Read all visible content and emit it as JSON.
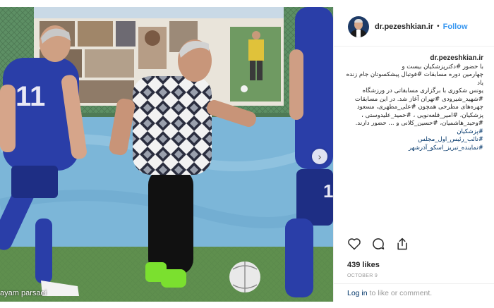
{
  "photo": {
    "credit": "ayam parsaei",
    "jersey_number_left": "11",
    "jersey_number_right": "1",
    "next_arrow": "chevron-right-icon"
  },
  "post": {
    "username": "dr.pezeshkian.ir",
    "separator": "•",
    "follow_label": "Follow",
    "caption": {
      "user": "dr.pezeshkian.ir",
      "lines": [
        "با حضور #دکترپزشکیان بیست و",
        "چهارمین دوره مسابقات #فوتبال پیشکسوتان جام زنده یاد",
        "یونس شکوری با برگزاری مسابقاتی در ورزشگاه",
        "#شهید_شیرودی #تهران آغاز شد. در این مسابقات",
        "چهره‌های مطرحی همچون #علی_مطهری، مسعود",
        "پزشکیان، #امیر_قلعه‌نویی ، #حمید_علیدوستی ،",
        "#وحید_هاشمیان، #حسین_کلانی و ... حضور دارند.",
        "#پزشکیان",
        "#نائب_رئیس_اول_مجلس",
        "#نماینده_تبریز_اسکو_آذرشهر"
      ]
    },
    "likes": "439 likes",
    "date": "OCTOBER 9",
    "footer": {
      "login_link": "Log in",
      "rest": " to like or comment."
    }
  },
  "icons": {
    "like": "heart-icon",
    "comment": "comment-icon",
    "share": "share-icon"
  },
  "colors": {
    "link": "#003569",
    "follow": "#3897f0",
    "jersey_blue": "#2a3ea8",
    "net_blue": "#7cb6d8"
  }
}
